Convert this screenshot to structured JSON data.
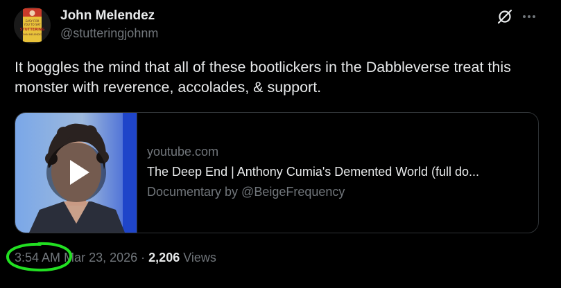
{
  "author": {
    "display_name": "John Melendez",
    "handle": "@stutteringjohnm",
    "avatar_icon": "book-cover-avatar",
    "avatar_lines": [
      "EASY FOR",
      "YOU TO SAY",
      "STUTTERING",
      "JOHN MELENDEZ"
    ]
  },
  "header_actions": {
    "grok_icon": "grok-icon",
    "more_icon": "more-horizontal-icon"
  },
  "tweet": {
    "text": "It boggles the mind that all of these bootlickers in the Dabbleverse treat this monster with reverence, accolades, & support."
  },
  "link_card": {
    "domain": "youtube.com",
    "title": "The Deep End | Anthony Cumia's Demented World (full do...",
    "description": "Documentary by @BeigeFrequency",
    "play_icon": "play-icon"
  },
  "meta": {
    "time": "3:54 AM",
    "separator": "·",
    "date": "Mar 23, 2026",
    "views_count": "2,206",
    "views_label": "Views"
  },
  "colors": {
    "background": "#000000",
    "text_primary": "#e7e9ea",
    "text_secondary": "#71767b",
    "border": "#2f3336",
    "annotation": "#22e022"
  }
}
